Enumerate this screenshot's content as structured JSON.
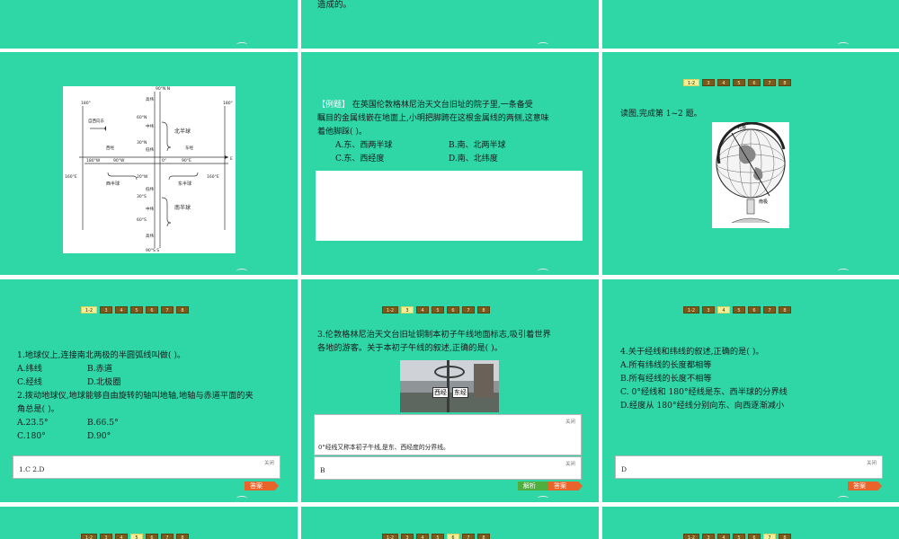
{
  "slide1": {
    "text": "造成的。"
  },
  "slide4": {
    "tags": [
      "高纬",
      "中纬",
      "低纬",
      "低纬",
      "中纬",
      "高纬"
    ],
    "lat_top": "90°N N",
    "lat_60n": "60°N",
    "lat_30n": "30°N",
    "lat_0": "0°",
    "lat_30s": "30°S",
    "lat_60s": "60°S",
    "lat_bottom": "90°S S",
    "lon_180_l": "180°",
    "lon_180_r": "180°",
    "west_to_east": "自西向东",
    "west_lon": "西经",
    "east_lon": "东经",
    "w180": "180°W",
    "w90": "90°W",
    "e90": "90°E",
    "e_label": "E",
    "w20": "20°W",
    "e160_l": "160°E",
    "e160_r": "160°E",
    "west_hemi": "西半球",
    "east_hemi": "东半球",
    "north_hemi": "北半球",
    "south_hemi": "南半球"
  },
  "slide5": {
    "example_tag": "【例题】",
    "line1": " 在英国伦敦格林尼治天文台旧址的院子里,一条备受",
    "line2": "瞩目的金属线嵌在地面上,小明把脚跨在这根金属线的两侧,这意味",
    "line3": "着他脚踩(      )。",
    "opts": [
      "A.东、西两半球",
      "B.南、北两半球",
      "C.东、西经度",
      "D.南、北纬度"
    ]
  },
  "slide6": {
    "nav": [
      "1-2",
      "3",
      "4",
      "5",
      "6",
      "7",
      "8"
    ],
    "prompt": "读图,完成第 1~2 题。",
    "globe_labels": [
      "北极",
      "南极"
    ]
  },
  "slide7": {
    "nav": [
      "1-2",
      "3",
      "4",
      "5",
      "6",
      "7",
      "8"
    ],
    "q1": "1.地球仪上,连接南北两极的半圆弧线叫做(      )。",
    "q1_opts": [
      "A.纬线",
      "B.赤道",
      "C.经线",
      "D.北极圈"
    ],
    "q2_l1": "2.拨动地球仪,地球能够自由旋转的轴叫地轴,地轴与赤道平面的夹",
    "q2_l2": "角总是(      )。",
    "q2_opts": [
      "A.23.5°",
      "B.66.5°",
      "C.180°",
      "D.90°"
    ],
    "close": "关闭",
    "answer_text": "1.C    2.D",
    "answer_btn": "答案"
  },
  "slide8": {
    "nav": [
      "1-2",
      "3",
      "4",
      "5",
      "6",
      "7",
      "8"
    ],
    "l1": "3.伦敦格林尼治天文台旧址铜制本初子午线地面标志,吸引着世界",
    "l2": "各地的游客。关于本初子午线的叙述,正确的是(      )。",
    "sign_left": "西经",
    "sign_right": "东经",
    "close1": "关闭",
    "analysis_text": "0°经线又称本初子午线,是东、西经度的分界线。",
    "close2": "关闭",
    "answer_text": "B",
    "analysis_btn": "解析",
    "answer_btn": "答案"
  },
  "slide9": {
    "nav": [
      "1-2",
      "3",
      "4",
      "5",
      "6",
      "7",
      "8"
    ],
    "q": "4.关于经线和纬线的叙述,正确的是(      )。",
    "opts": [
      "A.所有纬线的长度都相等",
      "B.所有经线的长度不相等",
      "C. 0°经线和 180°经线是东、西半球的分界线",
      "D.经度从 180°经线分别向东、向西逐渐减小"
    ],
    "close": "关闭",
    "answer_text": "D",
    "answer_btn": "答案"
  },
  "bottom_nav": [
    "1-2",
    "3",
    "4",
    "5",
    "6",
    "7",
    "8"
  ]
}
